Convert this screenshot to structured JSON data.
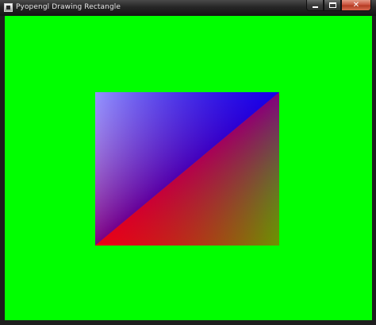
{
  "window": {
    "title": "Pyopengl Drawing Rectangle",
    "controls": {
      "minimize_icon": "minimize-icon",
      "maximize_icon": "maximize-icon",
      "close_icon": "close-icon",
      "close_glyph": "✕"
    }
  },
  "scene": {
    "background_color": "#00ff00",
    "rectangle": {
      "corner_colors": {
        "top_left": "#ffffff",
        "top_right": "#0000ff",
        "bottom_left": "#ff0000",
        "bottom_right": "#00ff00"
      }
    }
  }
}
